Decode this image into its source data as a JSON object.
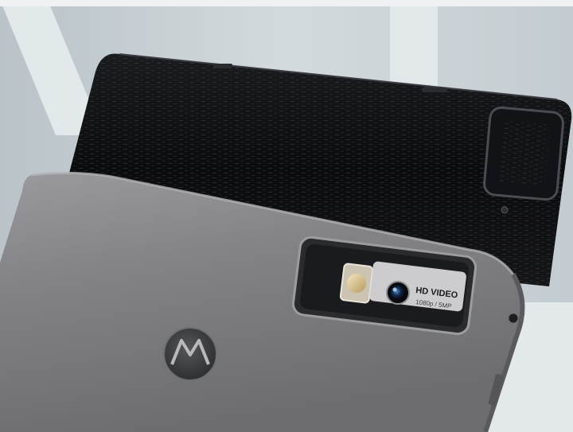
{
  "photo": {
    "camera_module": {
      "hd_label": "HD VIDEO",
      "spec_label": "1080p / 5MP"
    },
    "logo": {
      "icon": "motorola-logo-icon"
    },
    "colors": {
      "background_window": "#c9d2d7",
      "window_frame": "#e6ebee",
      "black_tablet": "#0f1012",
      "gray_tablet": "#7c7c80",
      "gray_tablet_highlight": "#98989c",
      "logo_badge": "#3d3e42"
    }
  }
}
